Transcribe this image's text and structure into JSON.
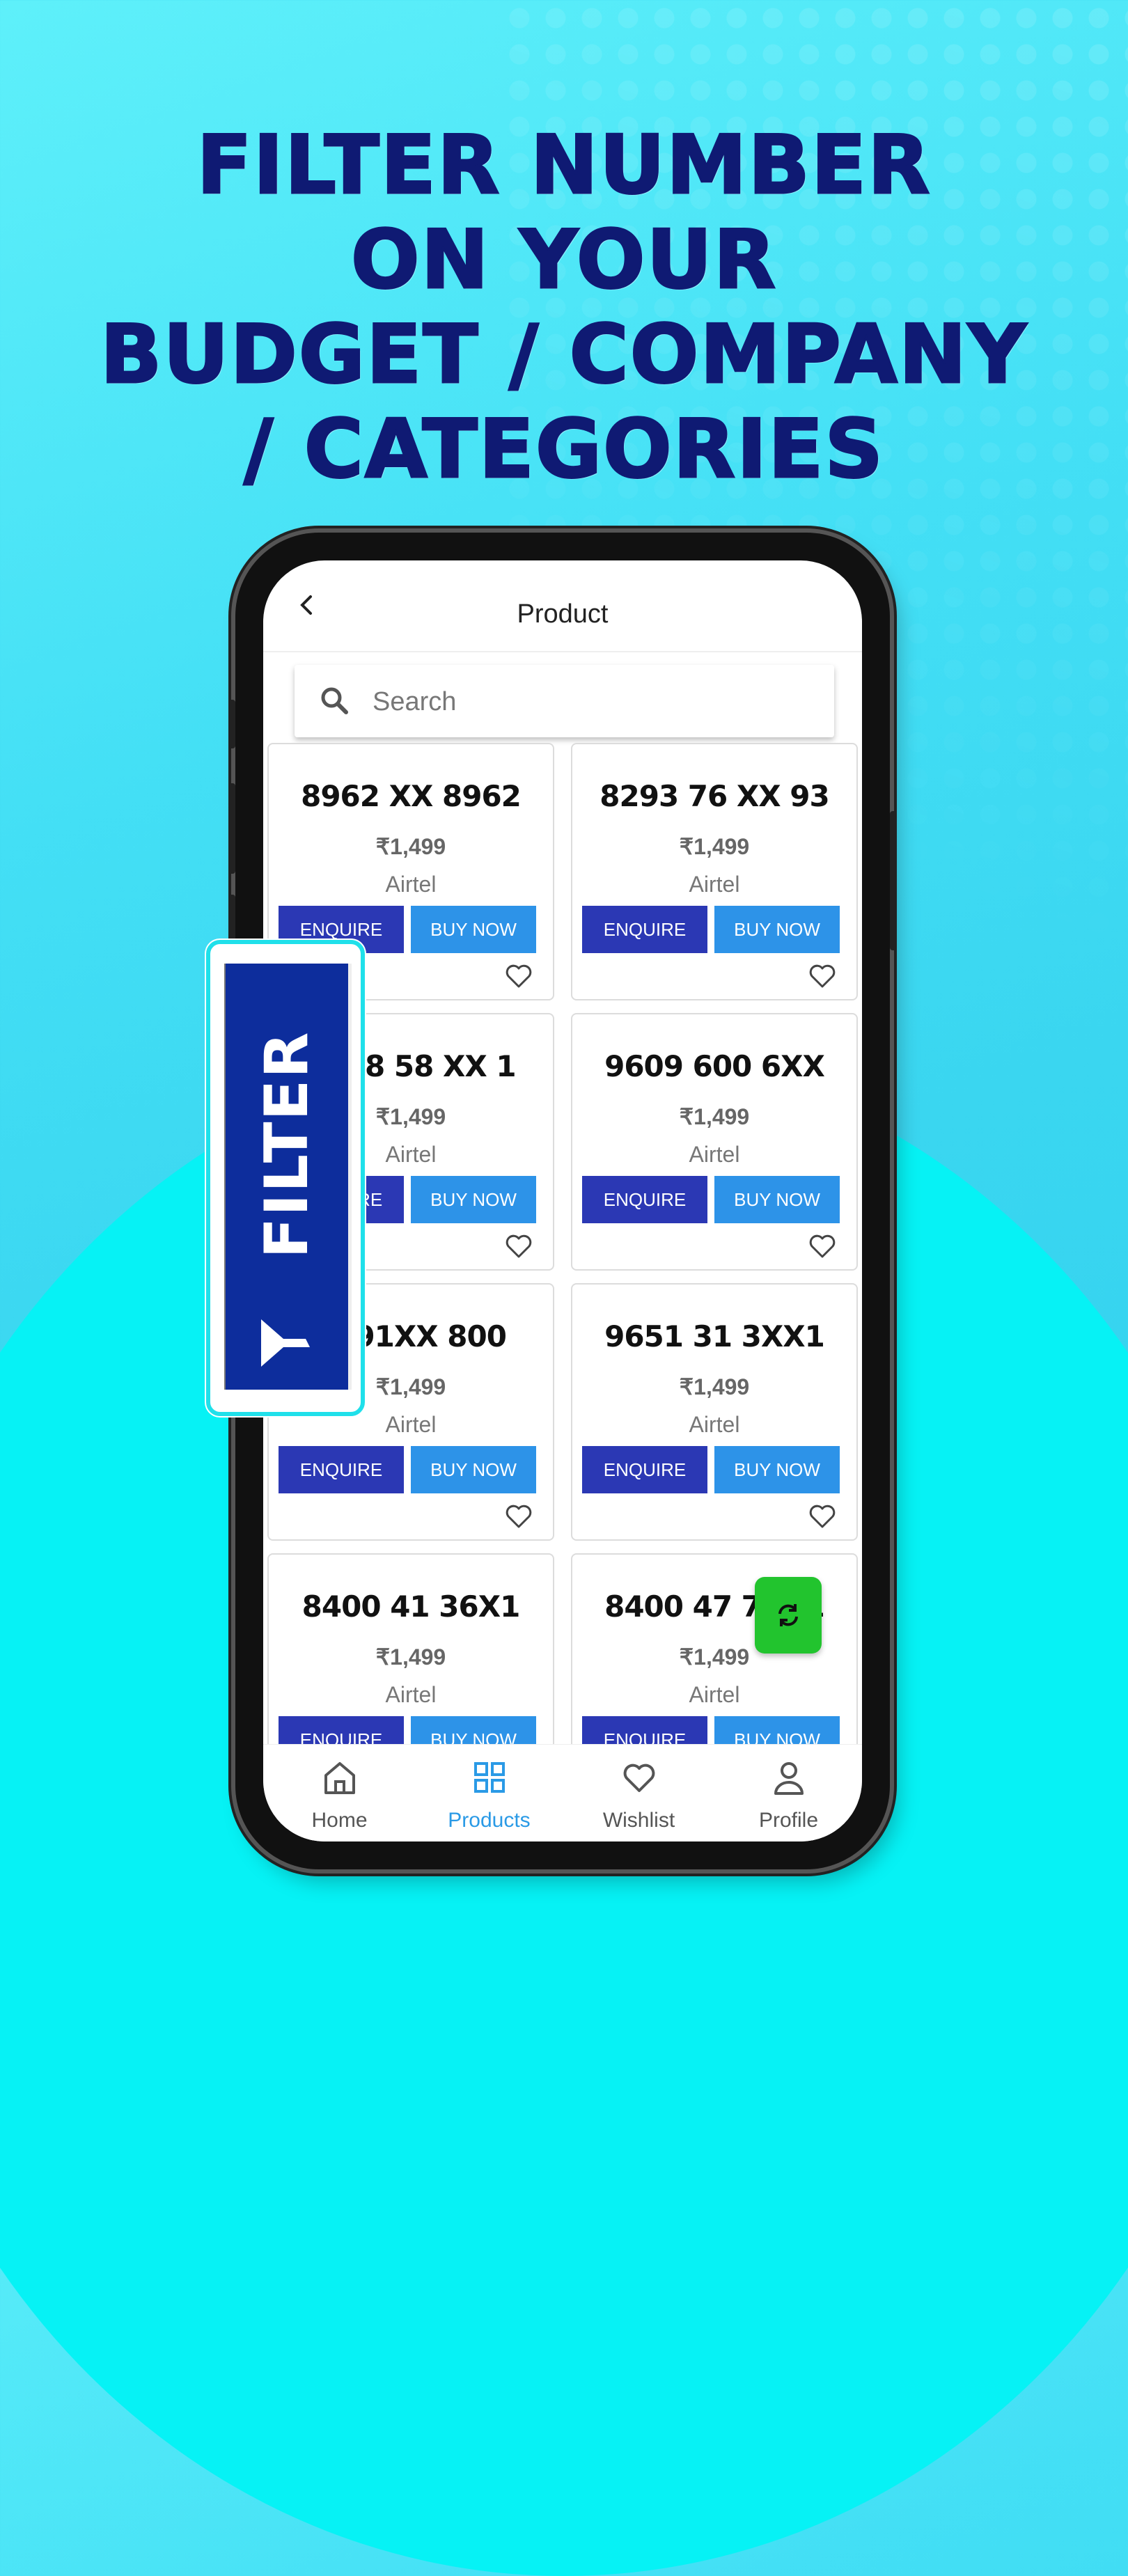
{
  "headline": {
    "lines": [
      "FILTER NUMBER",
      "ON YOUR",
      "BUDGET / COMPANY",
      "/ CATEGORIES"
    ]
  },
  "app": {
    "title": "Product",
    "search": {
      "placeholder": "Search",
      "value": ""
    },
    "products": [
      {
        "number": "8962 XX 8962",
        "price": "₹1,499",
        "operator": "Airtel"
      },
      {
        "number": "8293 76 XX 93",
        "price": "₹1,499",
        "operator": "Airtel"
      },
      {
        "number": "9608 58 XX 1",
        "price": "₹1,499",
        "operator": "Airtel"
      },
      {
        "number": "9609 600 6XX",
        "price": "₹1,499",
        "operator": "Airtel"
      },
      {
        "number": "9691XX 800",
        "price": "₹1,499",
        "operator": "Airtel"
      },
      {
        "number": "9651 31 3XX1",
        "price": "₹1,499",
        "operator": "Airtel"
      },
      {
        "number": "8400 41 36X1",
        "price": "₹1,499",
        "operator": "Airtel"
      },
      {
        "number": "8400 47 7XX1",
        "price": "₹1,499",
        "operator": "Airtel"
      }
    ],
    "buttons": {
      "enquire": "ENQUIRE",
      "buy_now": "BUY NOW"
    },
    "nav": [
      {
        "label": "Home",
        "icon": "home-icon",
        "active": false
      },
      {
        "label": "Products",
        "icon": "grid-icon",
        "active": true
      },
      {
        "label": "Wishlist",
        "icon": "heart-icon",
        "active": false
      },
      {
        "label": "Profile",
        "icon": "user-icon",
        "active": false
      }
    ],
    "filter_badge": {
      "label": "FILTER",
      "icon": "funnel-icon"
    },
    "refresh_button": {
      "icon": "refresh-icon"
    }
  },
  "colors": {
    "headline": "#0f1a73",
    "enquire": "#2b38b4",
    "buy_now": "#2d93e8",
    "active_nav": "#2a9ae6",
    "fab": "#22c42e",
    "filter_badge": "#0d2d9c",
    "background": "#06f2f5"
  }
}
